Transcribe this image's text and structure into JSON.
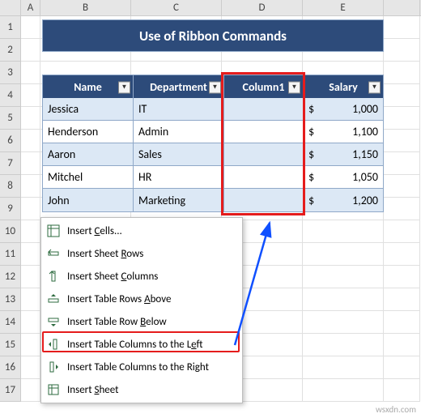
{
  "columns": [
    "A",
    "B",
    "C",
    "D",
    "E"
  ],
  "rows": [
    "1",
    "2",
    "3",
    "4",
    "5",
    "6",
    "7",
    "8",
    "9",
    "10",
    "11",
    "12",
    "13",
    "14",
    "15",
    "16",
    "17"
  ],
  "title": "Use of Ribbon Commands",
  "table": {
    "headers": {
      "name": "Name",
      "dept": "Department",
      "col1": "Column1",
      "salary": "Salary"
    },
    "rows": [
      {
        "name": "Jessica",
        "dept": "IT",
        "salary_sym": "$",
        "salary_val": "1,000"
      },
      {
        "name": "Henderson",
        "dept": "Admin",
        "salary_sym": "$",
        "salary_val": "1,100"
      },
      {
        "name": "Aaron",
        "dept": "Sales",
        "salary_sym": "$",
        "salary_val": "1,150"
      },
      {
        "name": "Mitchel",
        "dept": "HR",
        "salary_sym": "$",
        "salary_val": "1,050"
      },
      {
        "name": "John",
        "dept": "Marketing",
        "salary_sym": "$",
        "salary_val": "1,200"
      }
    ]
  },
  "menu": {
    "items": [
      "Insert Cells...",
      "Insert Sheet Rows",
      "Insert Sheet Columns",
      "Insert Table Rows Above",
      "Insert Table Row Below",
      "Insert Table Columns to the Left",
      "Insert Table Columns to the Right",
      "Insert Sheet"
    ],
    "mnemonic_pos": [
      7,
      13,
      13,
      18,
      17,
      29,
      30,
      7
    ]
  },
  "watermark": "wsxdn.com"
}
